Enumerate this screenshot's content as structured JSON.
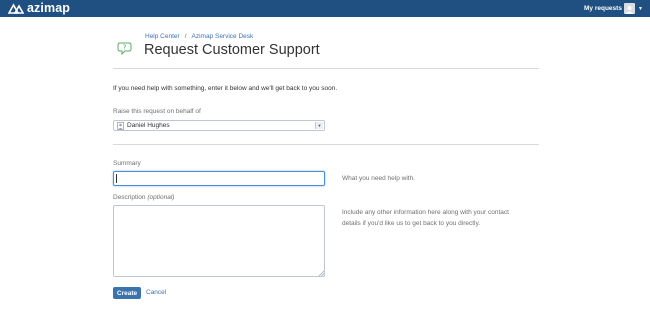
{
  "header": {
    "logo_text": "azimap",
    "my_requests_label": "My requests",
    "bar_color": "#205081"
  },
  "breadcrumb": {
    "items": [
      "Help Center",
      "Azimap Service Desk"
    ],
    "separator": "/"
  },
  "page": {
    "title": "Request Customer Support",
    "intro": "If you need help with something, enter it below and we'll get back to you soon."
  },
  "form": {
    "on_behalf": {
      "label": "Raise this request on behalf of",
      "value": "Daniel Hughes"
    },
    "summary": {
      "label": "Summary",
      "value": "",
      "help": "What you need help with."
    },
    "description": {
      "label": "Description",
      "optional": "(optional)",
      "value": "",
      "help_line1": "Include any other information here along with your contact",
      "help_line2": "details if you'd like us to get back to you directly."
    },
    "create_label": "Create",
    "cancel_label": "Cancel"
  },
  "icons": {
    "logo": "azimap-logo-icon",
    "avatar": "user-avatar-icon",
    "help": "help-chat-icon",
    "person": "person-icon",
    "dropdown": "chevron-down-icon"
  },
  "colors": {
    "link": "#3b73af",
    "primary_button": "#3b73af",
    "focus_border": "#4a8edb"
  }
}
